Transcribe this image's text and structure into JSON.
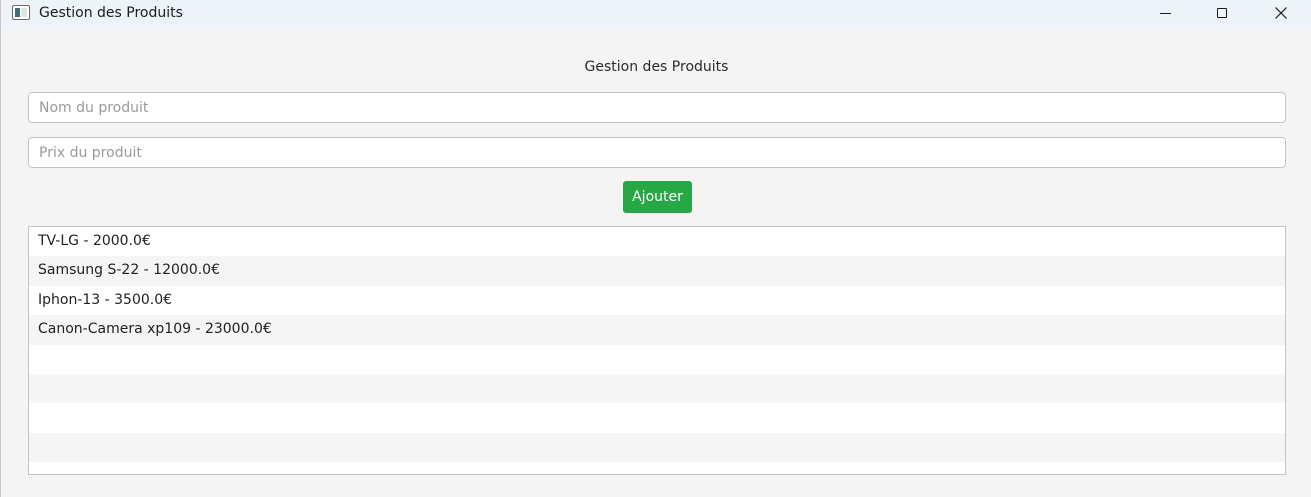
{
  "window": {
    "title": "Gestion des Produits",
    "controls": {
      "minimize": "minimize-icon",
      "maximize": "maximize-icon",
      "close": "close-icon"
    }
  },
  "main": {
    "heading": "Gestion des Produits",
    "name_input": {
      "value": "",
      "placeholder": "Nom du produit"
    },
    "price_input": {
      "value": "",
      "placeholder": "Prix du produit"
    },
    "add_button": "Ajouter",
    "products": [
      "TV-LG - 2000.0€",
      "Samsung S-22 - 12000.0€",
      "Iphon-13 - 3500.0€",
      "Canon-Camera xp109 - 23000.0€"
    ]
  },
  "colors": {
    "accent_button": "#28a745",
    "title_bar": "#eef2f9",
    "background": "#f4f4f4"
  }
}
